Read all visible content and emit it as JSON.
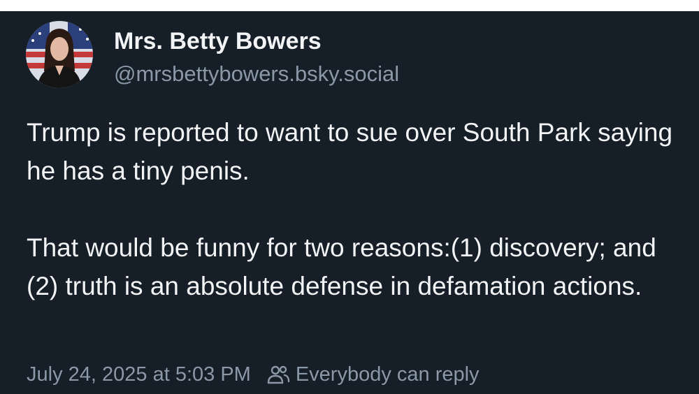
{
  "author": {
    "display_name": "Mrs. Betty Bowers",
    "handle": "@mrsbettybowers.bsky.social",
    "avatar_icon": "profile-photo"
  },
  "post": {
    "paragraphs": [
      "Trump is reported to want to sue over South Park saying he has a tiny penis.",
      "That would be funny for two reasons:(1) discovery; and (2) truth is an absolute defense in defamation actions."
    ],
    "timestamp": "July 24, 2025 at 5:03 PM",
    "reply_setting_icon": "people-icon",
    "reply_setting": "Everybody can reply"
  },
  "colors": {
    "background": "#161e27",
    "text": "#f1f3f5",
    "muted_text": "#8b98a8"
  }
}
